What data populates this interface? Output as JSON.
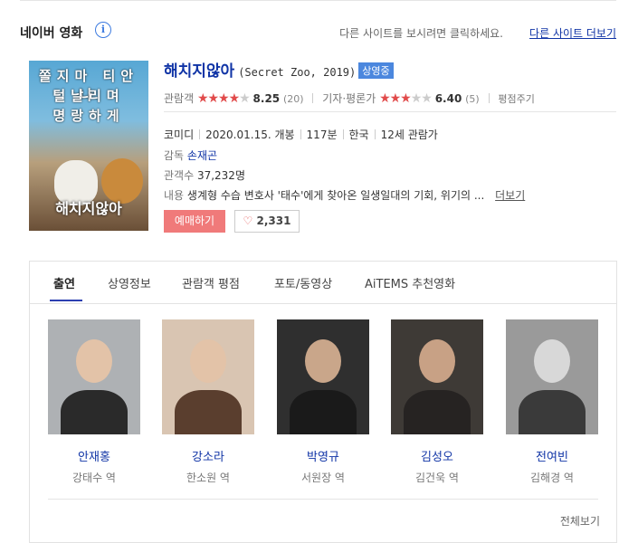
{
  "header": {
    "brand": "네이버 영화",
    "notice": "다른 사이트를 보시려면 클릭하세요.",
    "more_sites": "다른 사이트 더보기"
  },
  "poster": {
    "line1": "쫄지마 티안나",
    "line2": "털날리며",
    "line3": "명랑하게",
    "title": "해치지않아"
  },
  "movie": {
    "title": "해치지않아",
    "original": "(Secret Zoo, 2019)",
    "badge": "상영중",
    "audience_label": "관람객",
    "audience_score": "8.25",
    "audience_count": "(20)",
    "audience_stars": 4.1,
    "critic_label": "기자·평론가",
    "critic_score": "6.40",
    "critic_count": "(5)",
    "critic_stars": 3.2,
    "review_link": "평점주기",
    "genre": "코미디",
    "release": "2020.01.15. 개봉",
    "runtime": "117분",
    "country": "한국",
    "rating": "12세 관람가",
    "director_label": "감독",
    "director": "손재곤",
    "viewers_label": "관객수",
    "viewers": "37,232명",
    "desc_label": "내용",
    "desc": "생계형 수습 변호사 '태수'에게 찾아온 일생일대의 기회, 위기의 ...",
    "desc_more": "더보기",
    "book_label": "예매하기",
    "like_count": "2,331"
  },
  "tabs": [
    "출연",
    "상영정보",
    "관람객 평점",
    "포토/동영상",
    "AiTEMS 추천영화"
  ],
  "cast": [
    {
      "name": "안재홍",
      "role": "강태수 역"
    },
    {
      "name": "강소라",
      "role": "한소원 역"
    },
    {
      "name": "박영규",
      "role": "서원장 역"
    },
    {
      "name": "김성오",
      "role": "김건욱 역"
    },
    {
      "name": "전여빈",
      "role": "김해경 역"
    }
  ],
  "view_all": "전체보기"
}
